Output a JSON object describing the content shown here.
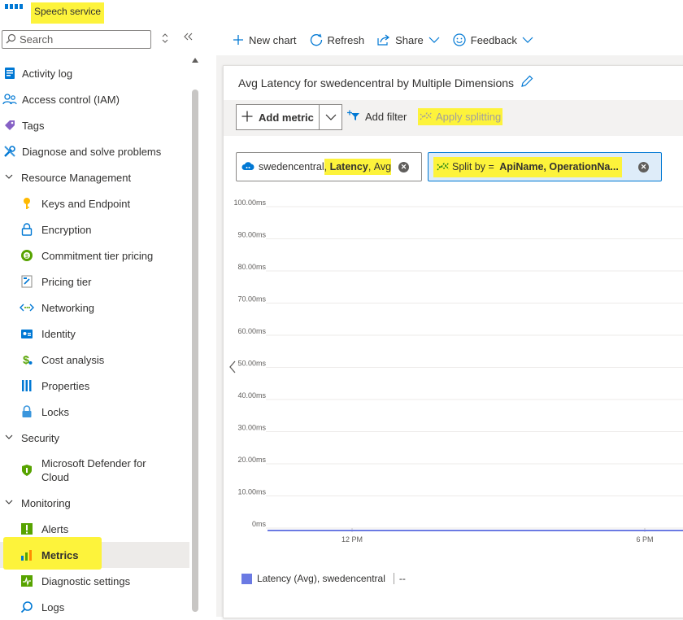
{
  "app": {
    "title": "Speech service"
  },
  "search": {
    "placeholder": "Search"
  },
  "sidebar": {
    "items": [
      {
        "label": "Activity log",
        "icon": "activity-log-icon"
      },
      {
        "label": "Access control (IAM)",
        "icon": "iam-icon"
      },
      {
        "label": "Tags",
        "icon": "tag-icon"
      },
      {
        "label": "Diagnose and solve problems",
        "icon": "wrench-icon"
      },
      {
        "label": "Resource Management",
        "group": true
      },
      {
        "label": "Keys and Endpoint",
        "icon": "key-icon"
      },
      {
        "label": "Encryption",
        "icon": "lock-icon"
      },
      {
        "label": "Commitment tier pricing",
        "icon": "commitment-icon"
      },
      {
        "label": "Pricing tier",
        "icon": "pricing-tier-icon"
      },
      {
        "label": "Networking",
        "icon": "networking-icon"
      },
      {
        "label": "Identity",
        "icon": "identity-icon"
      },
      {
        "label": "Cost analysis",
        "icon": "cost-analysis-icon"
      },
      {
        "label": "Properties",
        "icon": "properties-icon"
      },
      {
        "label": "Locks",
        "icon": "locks-icon"
      },
      {
        "label": "Security",
        "group": true
      },
      {
        "label": "Microsoft Defender for Cloud",
        "icon": "shield-icon"
      },
      {
        "label": "Monitoring",
        "group": true
      },
      {
        "label": "Alerts",
        "icon": "alerts-icon"
      },
      {
        "label": "Metrics",
        "icon": "metrics-icon",
        "active": true
      },
      {
        "label": "Diagnostic settings",
        "icon": "diagnostic-icon"
      },
      {
        "label": "Logs",
        "icon": "logs-icon"
      }
    ]
  },
  "toolbar": {
    "new_chart": "New chart",
    "refresh": "Refresh",
    "share": "Share",
    "feedback": "Feedback"
  },
  "chart_header": {
    "title": "Avg Latency for swedencentral by Multiple Dimensions"
  },
  "metric_bar": {
    "add_metric": "Add metric",
    "add_filter": "Add filter",
    "apply_splitting": "Apply splitting"
  },
  "pills": {
    "metric": {
      "scope": "swedencentral",
      "sep1": ",",
      "metric": "Latency",
      "sep2": ",",
      "agg": "Avg"
    },
    "split": {
      "prefix": "Split by = ",
      "value": "ApiName, OperationNa..."
    }
  },
  "colors": {
    "accent": "#0078d4",
    "series": "#6b7ae3",
    "highlight": "#fdf33b"
  },
  "chart_data": {
    "type": "line",
    "y_ticks": [
      "100.00ms",
      "90.00ms",
      "80.00ms",
      "70.00ms",
      "60.00ms",
      "50.00ms",
      "40.00ms",
      "30.00ms",
      "20.00ms",
      "10.00ms",
      "0ms"
    ],
    "x_ticks": [
      "12 PM",
      "6 PM"
    ],
    "ylim": [
      0,
      100
    ],
    "series": [
      {
        "name": "Latency (Avg), swedencentral",
        "values": [
          0,
          0
        ]
      }
    ],
    "legend_value": "--",
    "grid": true
  }
}
